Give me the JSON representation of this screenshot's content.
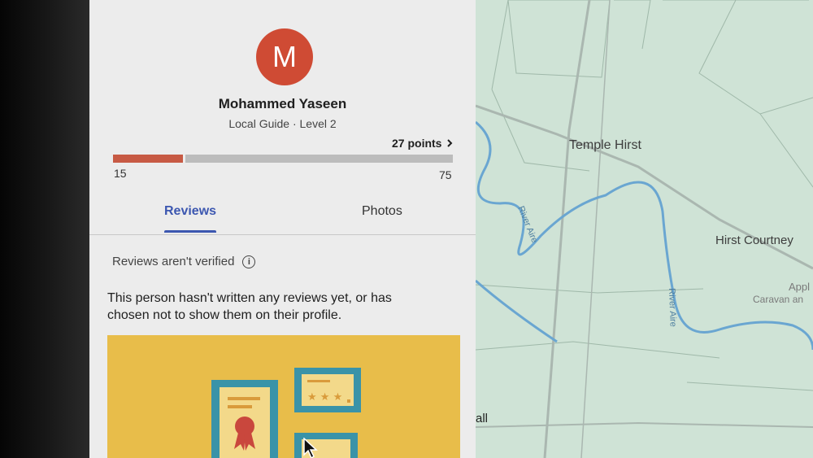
{
  "profile": {
    "avatar_letter": "M",
    "name": "Mohammed Yaseen",
    "level": "Local Guide · Level 2",
    "points": "27 points",
    "progress": {
      "min_label": "15",
      "max_label": "75",
      "fraction": 0.2
    }
  },
  "tabs": [
    {
      "label": "Reviews",
      "active": true
    },
    {
      "label": "Photos",
      "active": false
    }
  ],
  "reviews": {
    "verified_notice": "Reviews aren't verified",
    "empty_message": "This person hasn't written any reviews yet, or has chosen not to show them on their profile."
  },
  "map": {
    "places": [
      "Temple Hirst",
      "Hirst Courtney",
      "Appl",
      "Caravan an",
      "all"
    ],
    "rivers": [
      "River Aire",
      "River Aire"
    ]
  },
  "colors": {
    "avatar": "#cf4b34",
    "progress_fill": "#c75a44",
    "tab_active": "#3c57b0",
    "illustration_bg": "#e8bd4a",
    "map_bg": "#cfe3d6",
    "river": "#6aa6d1"
  },
  "icons": {
    "info": "info-icon",
    "chevron": "chevron-right-icon",
    "cursor": "mouse-cursor-icon"
  }
}
